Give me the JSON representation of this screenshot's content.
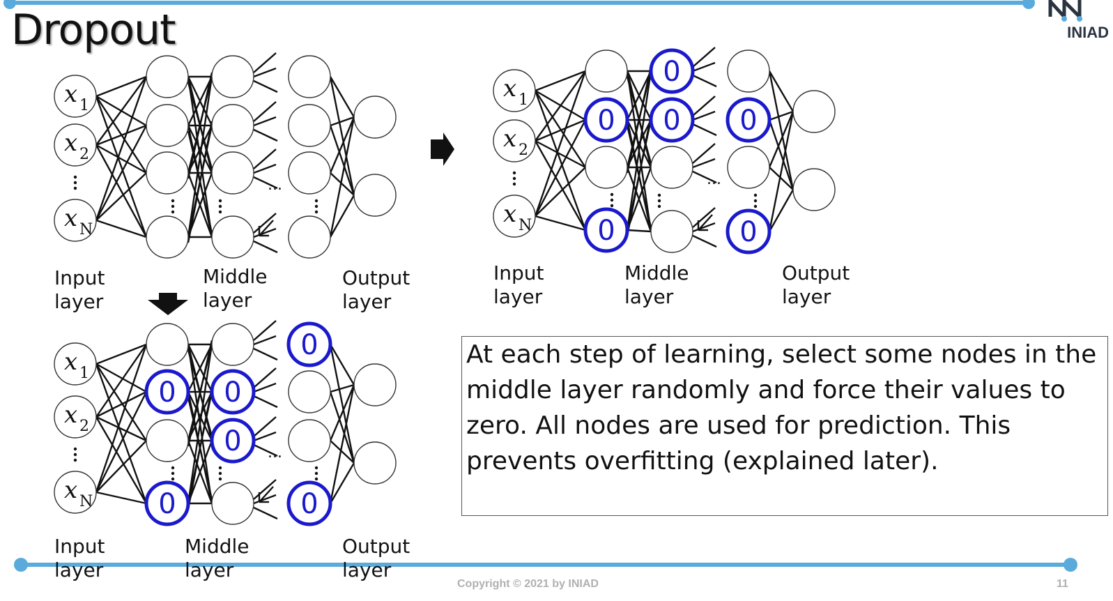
{
  "slide": {
    "title": "Dropout",
    "logo_text": "INIAD",
    "copyright": "Copyright © 2021 by INIAD",
    "page_number": "11",
    "accent_color": "#5aabdb",
    "zero_node_color": "#1a1acc"
  },
  "layer_labels": {
    "input": [
      "Input",
      "layer"
    ],
    "middle": [
      "Middle",
      "layer"
    ],
    "output": [
      "Output",
      "layer"
    ]
  },
  "node_text": {
    "zero": "0",
    "ellipsis": "...",
    "input_nodes": [
      {
        "base": "x",
        "sub": "1"
      },
      {
        "base": "x",
        "sub": "2"
      },
      {
        "base": "x",
        "sub": "N"
      }
    ]
  },
  "description": "At each step of learning, select some nodes in the middle layer randomly and force their values to zero. All nodes are used for prediction. This prevents overfitting (explained later).",
  "networks": [
    {
      "name": "original",
      "zeros": {
        "m1": [],
        "m2": [],
        "m3": []
      }
    },
    {
      "name": "dropout-step-a",
      "zeros": {
        "m1": [
          1,
          3
        ],
        "m2": [
          0,
          1
        ],
        "m3": [
          1,
          3
        ]
      }
    },
    {
      "name": "dropout-step-b",
      "zeros": {
        "m1": [
          1,
          3
        ],
        "m2": [
          1,
          2
        ],
        "m3": [
          0,
          3
        ]
      }
    }
  ]
}
